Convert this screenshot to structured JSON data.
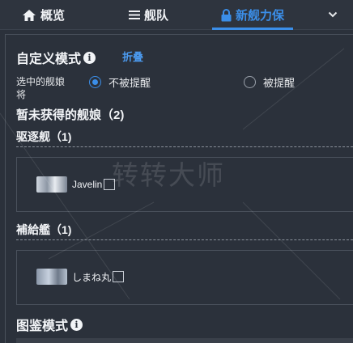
{
  "nav": {
    "tabs": [
      {
        "label": "概览",
        "icon": "home-icon",
        "active": false
      },
      {
        "label": "舰队",
        "icon": "list-icon",
        "active": false
      },
      {
        "label": "新舰力保",
        "icon": "lock-icon",
        "active": true
      }
    ],
    "more_icon": "chevron-down-icon"
  },
  "custom_mode": {
    "title": "自定义模式",
    "info_icon": "info-icon",
    "collapse_label": "折叠",
    "selected_label": "选中的舰娘将",
    "options": [
      {
        "label": "不被提醒",
        "checked": true
      },
      {
        "label": "被提醒",
        "checked": false
      }
    ],
    "unobtained_title": "暂未获得的舰娘（2)",
    "groups": [
      {
        "title": "驱逐舰（1)",
        "ships": [
          {
            "name": "Javelin",
            "checked": false
          }
        ]
      },
      {
        "title": "補給艦（1)",
        "ships": [
          {
            "name": "しまね丸",
            "checked": false
          }
        ]
      }
    ]
  },
  "collection_mode": {
    "title": "图鉴模式",
    "info_icon": "info-icon"
  },
  "watermark": "转转大师",
  "colors": {
    "background": "#2b313b",
    "accent": "#3b8ee8",
    "link": "#4c9bf0"
  }
}
